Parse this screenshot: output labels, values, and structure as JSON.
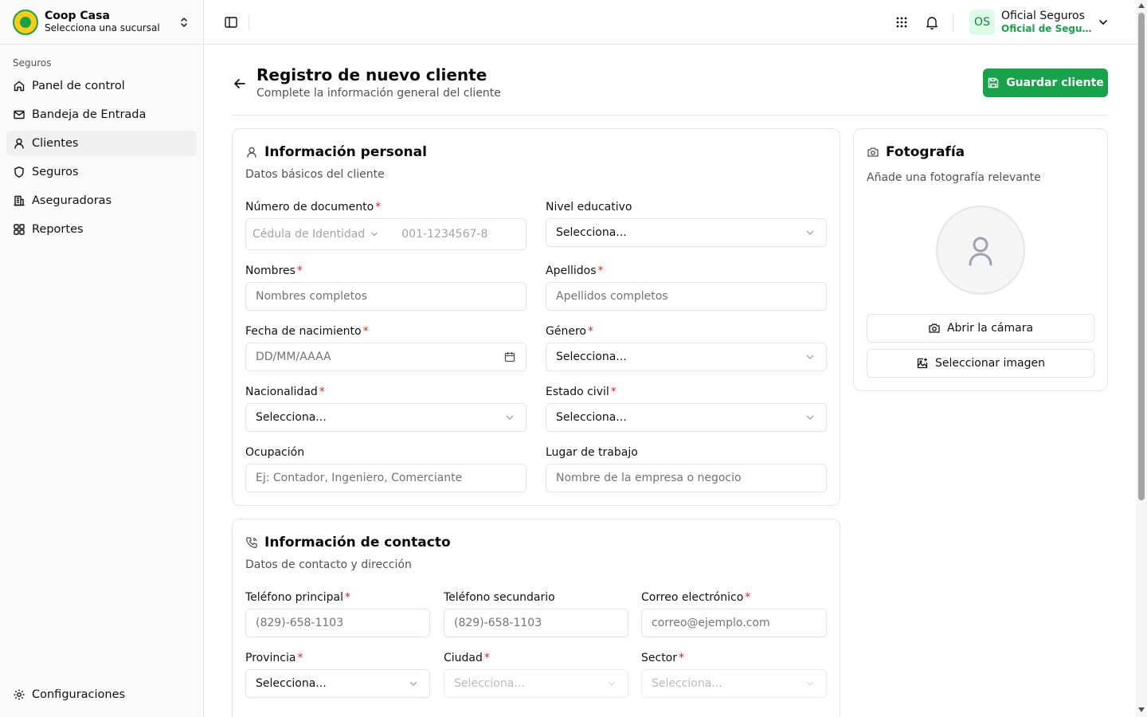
{
  "brand": {
    "name": "Coop Casa",
    "subtitle": "Selecciona una sucursal"
  },
  "sidebar": {
    "group_label": "Seguros",
    "items": [
      {
        "label": "Panel de control",
        "icon": "home-icon"
      },
      {
        "label": "Bandeja de Entrada",
        "icon": "mail-icon"
      },
      {
        "label": "Clientes",
        "icon": "user-icon",
        "active": true
      },
      {
        "label": "Seguros",
        "icon": "shield-icon"
      },
      {
        "label": "Aseguradoras",
        "icon": "building-icon"
      },
      {
        "label": "Reportes",
        "icon": "grid-icon"
      }
    ],
    "footer_item": {
      "label": "Configuraciones",
      "icon": "gear-icon"
    }
  },
  "topbar": {
    "user_initials": "OS",
    "user_name": "Oficial Seguros",
    "user_role": "Oficial de Seguros"
  },
  "header": {
    "title": "Registro de nuevo cliente",
    "subtitle": "Complete la información general del cliente",
    "save_label": "Guardar cliente"
  },
  "personal": {
    "title": "Información personal",
    "subtitle": "Datos básicos del cliente",
    "doc_label": "Número de documento",
    "doc_type": "Cédula de Identidad",
    "doc_placeholder": "001-1234567-8",
    "edu_label": "Nivel educativo",
    "edu_value": "Selecciona...",
    "names_label": "Nombres",
    "names_placeholder": "Nombres completos",
    "surnames_label": "Apellidos",
    "surnames_placeholder": "Apellidos completos",
    "birth_label": "Fecha de nacimiento",
    "birth_placeholder": "DD/MM/AAAA",
    "gender_label": "Género",
    "gender_value": "Selecciona...",
    "nationality_label": "Nacionalidad",
    "nationality_value": "Selecciona...",
    "civil_label": "Estado civil",
    "civil_value": "Selecciona...",
    "occupation_label": "Ocupación",
    "occupation_placeholder": "Ej: Contador, Ingeniero, Comerciante",
    "workplace_label": "Lugar de trabajo",
    "workplace_placeholder": "Nombre de la empresa o negocio"
  },
  "photo": {
    "title": "Fotografía",
    "subtitle": "Añade una fotografía relevante",
    "camera_label": "Abrir la cámara",
    "select_label": "Seleccionar imagen"
  },
  "contact": {
    "title": "Información de contacto",
    "subtitle": "Datos de contacto y dirección",
    "phone1_label": "Teléfono principal",
    "phone1_placeholder": "(829)-658-1103",
    "phone2_label": "Teléfono secundario",
    "phone2_placeholder": "(829)-658-1103",
    "email_label": "Correo electrónico",
    "email_placeholder": "correo@ejemplo.com",
    "province_label": "Provincia",
    "province_value": "Selecciona...",
    "city_label": "Ciudad",
    "city_value": "Selecciona...",
    "sector_label": "Sector",
    "sector_value": "Selecciona..."
  },
  "required_mark": "*",
  "colors": {
    "accent": "#16a34a",
    "required": "#dc2626",
    "avatar_bg": "#dcfce7"
  }
}
